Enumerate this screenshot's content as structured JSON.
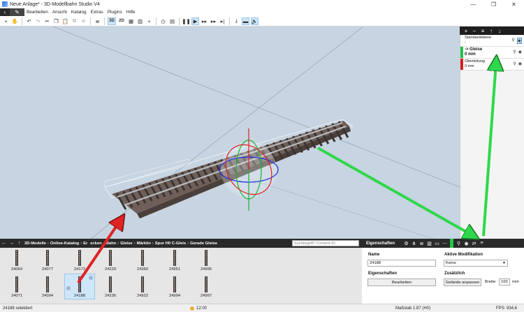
{
  "window": {
    "title": "Neue Anlage* - 3D-Modellbahn Studio V4",
    "controls": [
      "—",
      "❐",
      "✕"
    ]
  },
  "menu": {
    "back_icon": "back-icon",
    "edit_icon": "pencil-icon",
    "items": [
      "Bearbeiten",
      "Ansicht",
      "Katalog",
      "Extras",
      "Plugins",
      "Hilfe"
    ]
  },
  "toolbar": {
    "view_3d": "3D",
    "view_2d": "2D"
  },
  "layers_toolbar": [
    "+",
    "−",
    "≡",
    "↑",
    "↓"
  ],
  "layers": [
    {
      "name": "Standardebene",
      "sub": "-",
      "color": "#ffffff",
      "active": false
    },
    {
      "name": "-> Gleise",
      "sub": "0 mm",
      "color": "#22c24a",
      "active": true
    },
    {
      "name": "Oberleitung",
      "sub": "0 mm",
      "color": "#d42020",
      "active": false
    }
  ],
  "catalog": {
    "breadcrumb": [
      "3D-Modelle",
      "Online-Katalog",
      "Eisenbahn",
      "Bahn",
      "Gleise",
      "Märklin",
      "Spur H0 C-Gleis",
      "Gerade Gleise"
    ],
    "breadcrumb_display": [
      "3D-Modelle",
      "Online-Katalog",
      "Er",
      "ecken",
      "Bahn",
      "Gleise",
      "Märklin",
      "Spur H0 C-Gleis",
      "Gerade Gleise"
    ],
    "search_placeholder": "Suchbegriff / Content-ID",
    "items_row1": [
      "24064",
      "24077",
      "24172",
      "24229",
      "24360",
      "24951",
      "24995"
    ],
    "items_row2": [
      "24071",
      "24094",
      "24188",
      "24236",
      "24922",
      "24994",
      "24997"
    ],
    "selected": "24188"
  },
  "properties": {
    "title": "Eigenschaften",
    "name_label": "Name",
    "name_value": "24188",
    "mod_label": "Aktive Modifikation",
    "mod_value": "Keine",
    "props_label": "Eigenschaften",
    "edit_button": "Bearbeiten",
    "extra_label": "Zusätzlich",
    "terrain_button": "Gelände anpassen",
    "width_label": "Breite:",
    "width_value": "100",
    "width_unit": "mm"
  },
  "status": {
    "selection": "24188 selektiert",
    "time": "12:00",
    "scale": "Maßstab 1:87 (H0)",
    "fps": "FPS: 934,6"
  },
  "colors": {
    "annotation_green": "#2fd84a",
    "annotation_red": "#e02424",
    "viewport_bg": "#c7d4e1",
    "dark_bar": "#2a2a2a"
  }
}
